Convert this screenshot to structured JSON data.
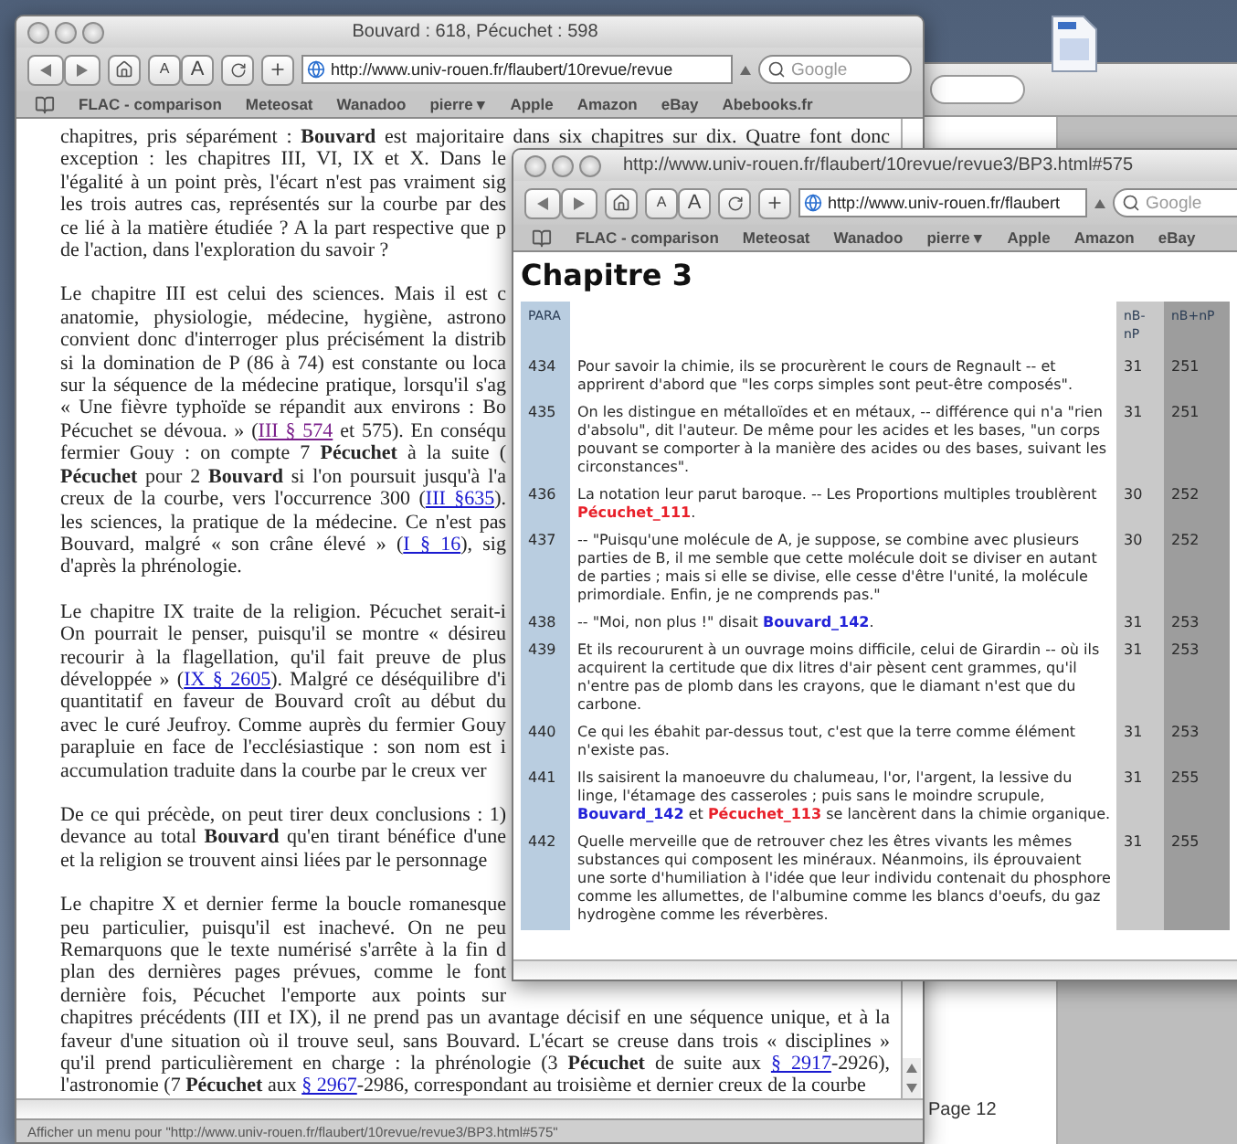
{
  "back_window": {
    "page_label": "Page 12"
  },
  "left_window": {
    "title": "Bouvard : 618, Pécuchet : 598",
    "text_size": [
      "A",
      "A"
    ],
    "address": "http://www.univ-rouen.fr/flaubert/10revue/revue",
    "search": {
      "placeholder": "Google"
    },
    "bookmarks": [
      "FLAC - comparison",
      "Meteosat",
      "Wanadoo",
      "pierre ▾",
      "Apple",
      "Amazon",
      "eBay",
      "Abebooks.fr"
    ],
    "paragraphs": [
      {
        "lines": [
          {
            "cut": false,
            "parts": [
              {
                "kind": "text",
                "text": "chapitres, pris séparément : **Bouvard** est majoritaire dans six chapitres sur dix. Quatre font donc"
              }
            ]
          },
          {
            "cut": true,
            "parts": [
              {
                "kind": "text",
                "text": "exception : les chapitres III, VI, IX et X. Dans le"
              }
            ]
          },
          {
            "cut": true,
            "parts": [
              {
                "kind": "text",
                "text": "l'égalité à un point près, l'écart n'est pas vraiment sig"
              }
            ]
          },
          {
            "cut": true,
            "parts": [
              {
                "kind": "text",
                "text": "les trois autres cas, représentés sur la courbe par des"
              }
            ]
          },
          {
            "cut": true,
            "parts": [
              {
                "kind": "text",
                "text": "ce lié à la matière étudiée ? A la part respective que p"
              }
            ]
          },
          {
            "cut": true,
            "parts": [
              {
                "kind": "text",
                "text": "de l'action, dans l'exploration du savoir ?"
              }
            ]
          }
        ]
      },
      {
        "lines": [
          {
            "cut": true,
            "parts": [
              {
                "kind": "text",
                "text": "Le chapitre III est celui des sciences. Mais il est c"
              }
            ]
          },
          {
            "cut": true,
            "parts": [
              {
                "kind": "text",
                "text": "anatomie, physiologie, médecine, hygiène, astrono"
              }
            ]
          },
          {
            "cut": true,
            "parts": [
              {
                "kind": "text",
                "text": "convient donc d'interroger plus précisément la distrib"
              }
            ]
          },
          {
            "cut": true,
            "parts": [
              {
                "kind": "text",
                "text": "si la domination de P (86 à 74) est constante ou loca"
              }
            ]
          },
          {
            "cut": true,
            "parts": [
              {
                "kind": "text",
                "text": "sur la séquence de la médecine pratique, lorsqu'il s'ag"
              }
            ]
          },
          {
            "cut": true,
            "parts": [
              {
                "kind": "text",
                "text": "« Une fièvre typhoïde se répandit aux environs : Bo"
              }
            ]
          },
          {
            "cut": true,
            "parts": [
              {
                "kind": "text",
                "text": "Pécuchet se dévoua. » ("
              },
              {
                "kind": "link",
                "text": "III § 574",
                "visited": true
              },
              {
                "kind": "text",
                "text": " et 575). En conséqu"
              }
            ]
          },
          {
            "cut": true,
            "parts": [
              {
                "kind": "text",
                "text": "fermier Gouy : on compte 7 **Pécuchet** à la suite ("
              }
            ]
          },
          {
            "cut": true,
            "parts": [
              {
                "kind": "text",
                "text": "**Pécuchet** pour 2 **Bouvard** si l'on poursuit jusqu'à l'a"
              }
            ]
          },
          {
            "cut": true,
            "parts": [
              {
                "kind": "text",
                "text": "creux de la courbe, vers l'occurrence 300 ("
              },
              {
                "kind": "link",
                "text": "III §635",
                "visited": false
              },
              {
                "kind": "text",
                "text": ")."
              }
            ]
          },
          {
            "cut": true,
            "parts": [
              {
                "kind": "text",
                "text": "les sciences, la pratique de la médecine. Ce n'est pas"
              }
            ]
          },
          {
            "cut": true,
            "parts": [
              {
                "kind": "text",
                "text": "Bouvard, malgré « son crâne élevé » ("
              },
              {
                "kind": "link",
                "text": "I § 16",
                "visited": false
              },
              {
                "kind": "text",
                "text": "), sig"
              }
            ]
          },
          {
            "cut": true,
            "parts": [
              {
                "kind": "text",
                "text": "d'après la phrénologie."
              }
            ]
          }
        ]
      },
      {
        "lines": [
          {
            "cut": true,
            "parts": [
              {
                "kind": "text",
                "text": "Le chapitre IX traite de la religion. Pécuchet serait-i"
              }
            ]
          },
          {
            "cut": true,
            "parts": [
              {
                "kind": "text",
                "text": "On pourrait le penser, puisqu'il se montre « désireu"
              }
            ]
          },
          {
            "cut": true,
            "parts": [
              {
                "kind": "text",
                "text": "recourir à la flagellation, qu'il fait preuve de plus"
              }
            ]
          },
          {
            "cut": true,
            "parts": [
              {
                "kind": "text",
                "text": "développée » ("
              },
              {
                "kind": "link",
                "text": "IX § 2605",
                "visited": false
              },
              {
                "kind": "text",
                "text": "). Malgré ce déséquilibre d'i"
              }
            ]
          },
          {
            "cut": true,
            "parts": [
              {
                "kind": "text",
                "text": "quantitatif en faveur de Bouvard croît au début du"
              }
            ]
          },
          {
            "cut": true,
            "parts": [
              {
                "kind": "text",
                "text": "avec le curé Jeufroy. Comme auprès du fermier Gouy"
              }
            ]
          },
          {
            "cut": true,
            "parts": [
              {
                "kind": "text",
                "text": "parapluie en face de l'ecclésiastique : son nom est i"
              }
            ]
          },
          {
            "cut": true,
            "parts": [
              {
                "kind": "text",
                "text": "accumulation traduite dans la courbe par le creux ver"
              }
            ]
          }
        ]
      },
      {
        "lines": [
          {
            "cut": true,
            "parts": [
              {
                "kind": "text",
                "text": "De ce qui précède, on peut tirer deux conclusions : 1)"
              }
            ]
          },
          {
            "cut": true,
            "parts": [
              {
                "kind": "text",
                "text": "devance au total **Bouvard** qu'en tirant bénéfice d'une"
              }
            ]
          },
          {
            "cut": true,
            "parts": [
              {
                "kind": "text",
                "text": "et la religion se trouvent ainsi liées par le personnage"
              }
            ]
          }
        ]
      },
      {
        "lines": [
          {
            "cut": true,
            "parts": [
              {
                "kind": "text",
                "text": "Le chapitre X et dernier ferme la boucle romanesque"
              }
            ]
          },
          {
            "cut": true,
            "parts": [
              {
                "kind": "text",
                "text": "peu particulier, puisqu'il est inachevé. On ne peu"
              }
            ]
          },
          {
            "cut": true,
            "parts": [
              {
                "kind": "text",
                "text": "Remarquons que le texte numérisé s'arrête à la fin d"
              }
            ]
          },
          {
            "cut": true,
            "parts": [
              {
                "kind": "text",
                "text": "plan des dernières pages prévues, comme le font"
              }
            ]
          },
          {
            "cut": true,
            "parts": [
              {
                "kind": "text",
                "text": "dernière fois, Pécuchet l'emporte aux points sur"
              }
            ]
          },
          {
            "cut": false,
            "parts": [
              {
                "kind": "text",
                "text": "chapitres précédents (III et IX), il ne prend pas un avantage décisif en une séquence unique, et à la"
              }
            ]
          },
          {
            "cut": false,
            "parts": [
              {
                "kind": "text",
                "text": "faveur d'une situation où il trouve seul, sans Bouvard. L'écart se creuse dans trois « disciplines »"
              }
            ]
          },
          {
            "cut": false,
            "parts": [
              {
                "kind": "text",
                "text": "qu'il prend particulièrement en charge : la phrénologie (3 **Pécuchet** de suite aux "
              },
              {
                "kind": "link",
                "text": "§ 2917",
                "visited": false
              },
              {
                "kind": "text",
                "text": "-2926),"
              }
            ]
          },
          {
            "cut": false,
            "parts": [
              {
                "kind": "text",
                "text": "l'astronomie (7 **Pécuchet** aux "
              },
              {
                "kind": "link",
                "text": "§ 2967",
                "visited": false
              },
              {
                "kind": "text",
                "text": "-2986, correspondant au troisième et dernier creux de la courbe"
              }
            ]
          }
        ]
      }
    ],
    "status_bar": "Afficher un menu pour \"http://www.univ-rouen.fr/flaubert/10revue/revue3/BP3.html#575\""
  },
  "right_window": {
    "title": "http://www.univ-rouen.fr/flaubert/10revue/revue3/BP3.html#575",
    "text_size": [
      "A",
      "A"
    ],
    "address": "http://www.univ-rouen.fr/flaubert",
    "search": {
      "placeholder": "Google"
    },
    "bookmarks": [
      "FLAC - comparison",
      "Meteosat",
      "Wanadoo",
      "pierre ▾",
      "Apple",
      "Amazon",
      "eBay"
    ],
    "heading": "Chapitre 3",
    "table": {
      "header": {
        "para": "PARA",
        "nb_minus_np": "nB-nP",
        "nb_plus_np": "nB+nP"
      },
      "rows": [
        {
          "para": "434",
          "parts": [
            {
              "kind": "text",
              "text": "Pour savoir la chimie, ils se procurèrent le cours de Regnault -- et apprirent d'abord que \"les corps simples sont peut-être composés\"."
            }
          ],
          "nb_minus_np": "31",
          "nb_plus_np": "251"
        },
        {
          "para": "435",
          "parts": [
            {
              "kind": "text",
              "text": "On les distingue en métalloïdes et en métaux, -- différence qui n'a \"rien d'absolu\", dit l'auteur. De même pour les acides et les bases, \"un corps pouvant se comporter à la manière des acides ou des bases, suivant les circonstances\"."
            }
          ],
          "nb_minus_np": "31",
          "nb_plus_np": "251"
        },
        {
          "para": "436",
          "parts": [
            {
              "kind": "text",
              "text": "La notation leur parut baroque. -- Les Proportions multiples troublèrent "
            },
            {
              "kind": "name",
              "text": "Pécuchet_111",
              "color": "#e8202a"
            },
            {
              "kind": "text",
              "text": "."
            }
          ],
          "nb_minus_np": "30",
          "nb_plus_np": "252"
        },
        {
          "para": "437",
          "parts": [
            {
              "kind": "text",
              "text": "-- \"Puisqu'une molécule de A, je suppose, se combine avec plusieurs parties de B, il me semble que cette molécule doit se diviser en autant de parties ; mais si elle se divise, elle cesse d'être l'unité, la molécule primordiale. Enfin, je ne comprends pas.\""
            }
          ],
          "nb_minus_np": "30",
          "nb_plus_np": "252"
        },
        {
          "para": "438",
          "parts": [
            {
              "kind": "text",
              "text": "-- \"Moi, non plus !\" disait "
            },
            {
              "kind": "name",
              "text": "Bouvard_142",
              "color": "#2222d8"
            },
            {
              "kind": "text",
              "text": "."
            }
          ],
          "nb_minus_np": "31",
          "nb_plus_np": "253"
        },
        {
          "para": "439",
          "parts": [
            {
              "kind": "text",
              "text": "Et ils recoururent à un ouvrage moins difficile, celui de Girardin -- où ils acquirent la certitude que dix litres d'air pèsent cent grammes, qu'il n'entre pas de plomb dans les crayons, que le diamant n'est que du carbone."
            }
          ],
          "nb_minus_np": "31",
          "nb_plus_np": "253"
        },
        {
          "para": "440",
          "parts": [
            {
              "kind": "text",
              "text": "Ce qui les ébahit par-dessus tout, c'est que la terre comme élément n'existe pas."
            }
          ],
          "nb_minus_np": "31",
          "nb_plus_np": "253"
        },
        {
          "para": "441",
          "parts": [
            {
              "kind": "text",
              "text": "Ils saisirent la manoeuvre du chalumeau, l'or, l'argent, la lessive du linge, l'étamage des casseroles ; puis sans le moindre scrupule, "
            },
            {
              "kind": "name",
              "text": "Bouvard_142",
              "color": "#2222d8"
            },
            {
              "kind": "text",
              "text": " et "
            },
            {
              "kind": "name",
              "text": "Pécuchet_113",
              "color": "#e8202a"
            },
            {
              "kind": "text",
              "text": " se lancèrent dans la chimie organique."
            }
          ],
          "nb_minus_np": "31",
          "nb_plus_np": "255"
        },
        {
          "para": "442",
          "parts": [
            {
              "kind": "text",
              "text": "Quelle merveille que de retrouver chez les êtres vivants les mêmes substances qui composent les minéraux. Néanmoins, ils éprouvaient une sorte d'humiliation à l'idée que leur individu contenait du phosphore comme les allumettes, de l'albumine comme les blancs d'oeufs, du gaz hydrogène comme les réverbères."
            }
          ],
          "nb_minus_np": "31",
          "nb_plus_np": "255"
        }
      ]
    }
  }
}
